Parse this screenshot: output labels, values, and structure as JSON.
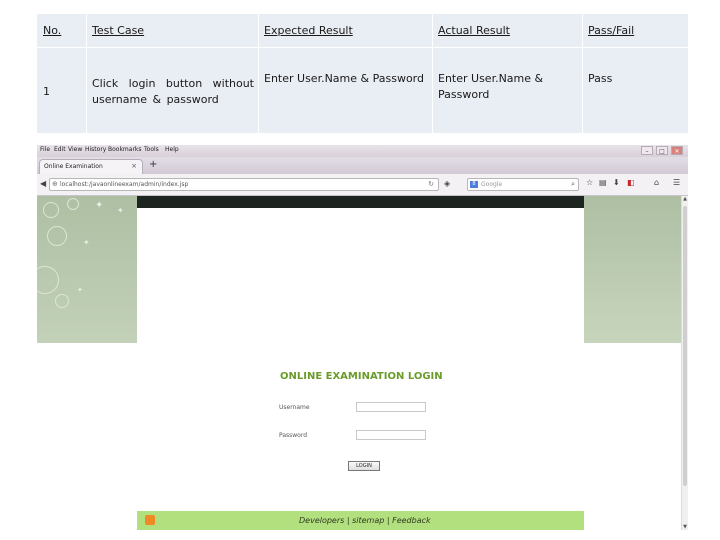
{
  "table": {
    "headers": [
      "No.",
      "Test Case",
      "Expected Result",
      "Actual Result",
      "Pass/Fail"
    ],
    "rows": [
      {
        "no": "1",
        "test_case": "Click login button without username & password",
        "expected": "Enter User.Name & Password",
        "actual": "Enter User.Name & Password",
        "result": "Pass"
      }
    ]
  },
  "browser": {
    "menu": [
      "File",
      "Edit",
      "View",
      "History",
      "Bookmarks",
      "Tools",
      "Help"
    ],
    "window_controls": [
      "–",
      "□",
      "✕"
    ],
    "tab_title": "Online Examination",
    "tab_close": "×",
    "new_tab": "+",
    "url": "localhost:/javaonlineexam/admin/index.jsp",
    "search_placeholder": "Google",
    "search_engine_badge": "8",
    "nav_icons": [
      "back-icon",
      "reload-icon",
      "star-icon",
      "download-icon",
      "home-icon",
      "menu-icon"
    ]
  },
  "page": {
    "login_title": "ONLINE EXAMINATION LOGIN",
    "username_label": "Username",
    "password_label": "Password",
    "login_button": "LOGIN",
    "footer": "Developers | sitemap | Feedback"
  },
  "colors": {
    "table_bg": "#e9edf4",
    "login_title": "#6a9c2b",
    "footer_bg": "#b2e07f",
    "side_bg": "#aebfa4"
  }
}
